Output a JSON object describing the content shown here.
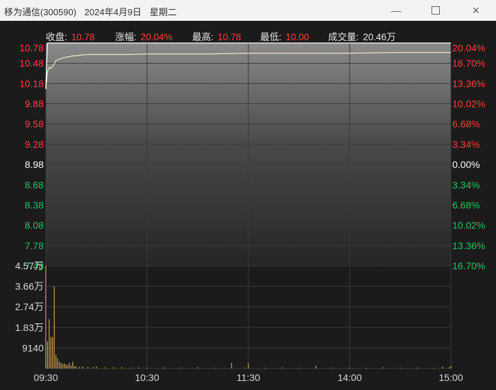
{
  "window": {
    "stock_name": "移为通信(300590)",
    "date": "2024年4月9日",
    "weekday": "星期二",
    "minimize_glyph": "—",
    "close_glyph": "✕"
  },
  "info": {
    "close_label": "收盘:",
    "close_value": "10.78",
    "change_label": "涨幅:",
    "change_value": "20.04%",
    "high_label": "最高:",
    "high_value": "10.78",
    "low_label": "最低:",
    "low_value": "10.00",
    "volume_label": "成交量:",
    "volume_value": "20.46万"
  },
  "colors": {
    "up": "#ff3b3b",
    "down": "#22c55e",
    "neutral": "#ffffff",
    "price_line": "#efe6c4",
    "volume_bar": "#c9a449",
    "grid": "#3a3a3a",
    "axis_text": "#d8d8d8"
  },
  "chart_data": [
    {
      "type": "line",
      "panel": "price",
      "y_left_ticks": [
        "10.78",
        "10.48",
        "10.18",
        "9.88",
        "9.58",
        "9.28",
        "8.98",
        "8.68",
        "8.38",
        "8.08",
        "7.78",
        "7.48"
      ],
      "y_right_ticks": [
        "20.04%",
        "16.70%",
        "13.36%",
        "10.02%",
        "6.68%",
        "3.34%",
        "0.00%",
        "3.34%",
        "6.68%",
        "10.02%",
        "13.36%",
        "16.70%"
      ],
      "ylim": [
        7.48,
        10.78
      ],
      "prev_close": 8.98,
      "x_ticks": [
        "09:30",
        "10:30",
        "11:30",
        "14:00",
        "15:00"
      ],
      "xlim_minutes": [
        0,
        240
      ],
      "series": [
        {
          "x": [
            0,
            1,
            2,
            3,
            4,
            5,
            6,
            7,
            8,
            9,
            10,
            12,
            14,
            16,
            18,
            20,
            25,
            30,
            40,
            50,
            60,
            80,
            100,
            120,
            150,
            180,
            210,
            240
          ],
          "price": [
            10.1,
            10.78,
            10.78,
            10.78,
            10.78,
            10.78,
            10.78,
            10.78,
            10.78,
            10.78,
            10.78,
            10.78,
            10.78,
            10.78,
            10.78,
            10.78,
            10.78,
            10.78,
            10.78,
            10.78,
            10.78,
            10.78,
            10.78,
            10.78,
            10.78,
            10.78,
            10.78,
            10.78
          ],
          "avg": [
            10.1,
            10.35,
            10.42,
            10.4,
            10.44,
            10.47,
            10.52,
            10.53,
            10.54,
            10.55,
            10.56,
            10.57,
            10.58,
            10.59,
            10.59,
            10.6,
            10.61,
            10.61,
            10.61,
            10.61,
            10.62,
            10.62,
            10.62,
            10.63,
            10.63,
            10.63,
            10.64,
            10.64
          ]
        }
      ]
    },
    {
      "type": "bar",
      "panel": "volume",
      "y_ticks": [
        "4.57万",
        "3.66万",
        "2.74万",
        "1.83万",
        "9140"
      ],
      "ylim": [
        0,
        45700
      ],
      "x_minutes": [
        0,
        1,
        2,
        3,
        4,
        5,
        6,
        7,
        8,
        9,
        10,
        11,
        12,
        13,
        14,
        15,
        16,
        17,
        18,
        20,
        22,
        25,
        28,
        30,
        35,
        40,
        45,
        50,
        55,
        60,
        70,
        80,
        90,
        100,
        110,
        118,
        120,
        130,
        140,
        150,
        160,
        170,
        180,
        190,
        200,
        210,
        220,
        230,
        235,
        239,
        240
      ],
      "values": [
        45700,
        12000,
        22000,
        14000,
        14000,
        36500,
        6000,
        4500,
        3000,
        2500,
        2000,
        2200,
        1800,
        1500,
        2500,
        1200,
        3000,
        1000,
        900,
        800,
        900,
        700,
        600,
        900,
        500,
        500,
        600,
        400,
        500,
        400,
        500,
        400,
        600,
        300,
        2500,
        400,
        2500,
        300,
        500,
        300,
        1200,
        400,
        400,
        300,
        500,
        300,
        400,
        300,
        800,
        600,
        1200
      ]
    }
  ]
}
